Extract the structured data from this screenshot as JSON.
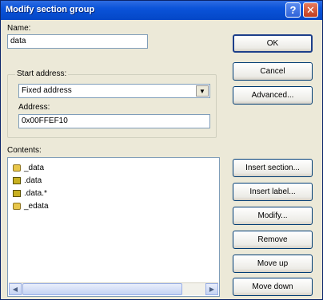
{
  "window": {
    "title": "Modify section group",
    "help_label": "?",
    "close_label": "✕"
  },
  "name": {
    "label": "Name:",
    "value": "data"
  },
  "start_address": {
    "group_label": "Start address:",
    "selected": "Fixed address",
    "address_label": "Address:",
    "address_value": "0x00FFEF10"
  },
  "contents": {
    "label": "Contents:",
    "items": [
      {
        "label": "_data",
        "icon": "folder-icon"
      },
      {
        "label": ".data",
        "icon": "section-icon"
      },
      {
        "label": ".data.*",
        "icon": "section-icon"
      },
      {
        "label": "_edata",
        "icon": "folder-icon"
      }
    ]
  },
  "buttons": {
    "ok": "OK",
    "cancel": "Cancel",
    "advanced": "Advanced...",
    "insert_section": "Insert section...",
    "insert_label": "Insert label...",
    "modify": "Modify...",
    "remove": "Remove",
    "move_up": "Move up",
    "move_down": "Move down"
  }
}
